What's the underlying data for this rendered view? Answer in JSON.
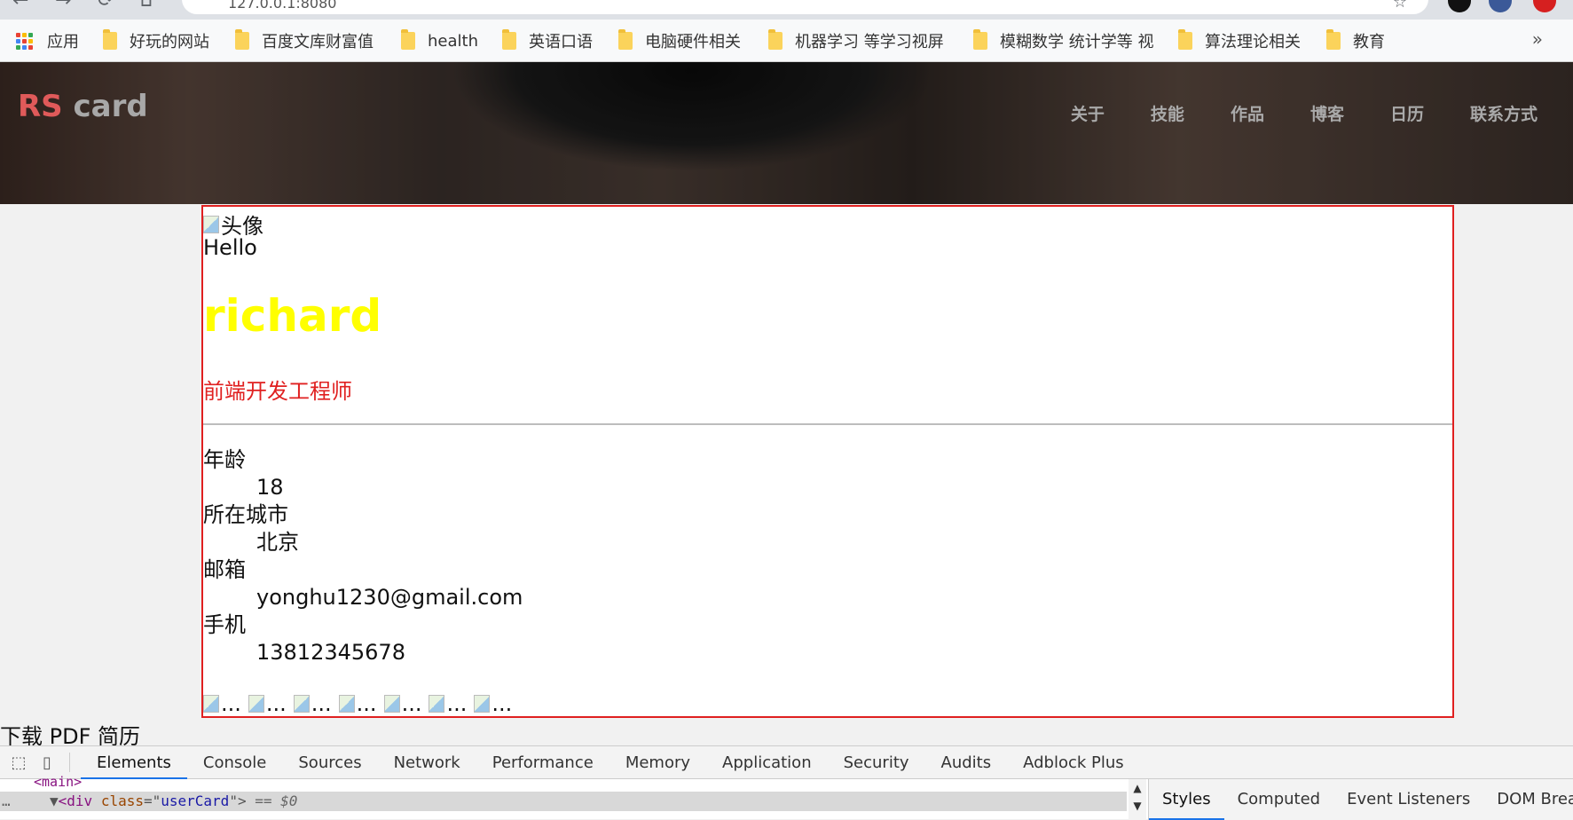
{
  "browser": {
    "url": "127.0.0.1:8080",
    "bookmarks": {
      "apps_label": "应用",
      "items": [
        "好玩的网站",
        "百度文库财富值",
        "health",
        "英语口语",
        "电脑硬件相关",
        "机器学习 等学习视屏",
        "模糊数学 统计学等 视",
        "算法理论相关",
        "教育"
      ],
      "more_label": "»"
    }
  },
  "header": {
    "logo_rs": "RS",
    "logo_card": "card",
    "nav": [
      "关于",
      "技能",
      "作品",
      "博客",
      "日历",
      "联系方式"
    ]
  },
  "card": {
    "avatar_alt": "头像",
    "hello": "Hello",
    "name": "richard",
    "job_title": "前端开发工程师",
    "info": [
      {
        "label": "年龄",
        "value": "18"
      },
      {
        "label": "所在城市",
        "value": "北京"
      },
      {
        "label": "邮箱",
        "value": "yonghu1230@gmail.com"
      },
      {
        "label": "手机",
        "value": "13812345678"
      }
    ],
    "social_alts": [
      "...",
      "...",
      "...",
      "...",
      "...",
      "...",
      "..."
    ]
  },
  "pdf_link": "下载 PDF 简历",
  "devtools": {
    "tabs": [
      "Elements",
      "Console",
      "Sources",
      "Network",
      "Performance",
      "Memory",
      "Application",
      "Security",
      "Audits",
      "Adblock Plus"
    ],
    "active_tab": "Elements",
    "dom_prev": "<main>",
    "dom_tag_open": "<div ",
    "dom_attr": "class",
    "dom_eq": "=\"",
    "dom_val": "userCard",
    "dom_close": "\">",
    "dom_marker": " == $0",
    "side_tabs": [
      "Styles",
      "Computed",
      "Event Listeners",
      "DOM Breakpoints"
    ],
    "active_side_tab": "Styles"
  },
  "colors": {
    "card_border": "#e02020",
    "name_color": "#ffff00",
    "title_color": "#e02020",
    "logo_rs": "#e05a5a"
  }
}
